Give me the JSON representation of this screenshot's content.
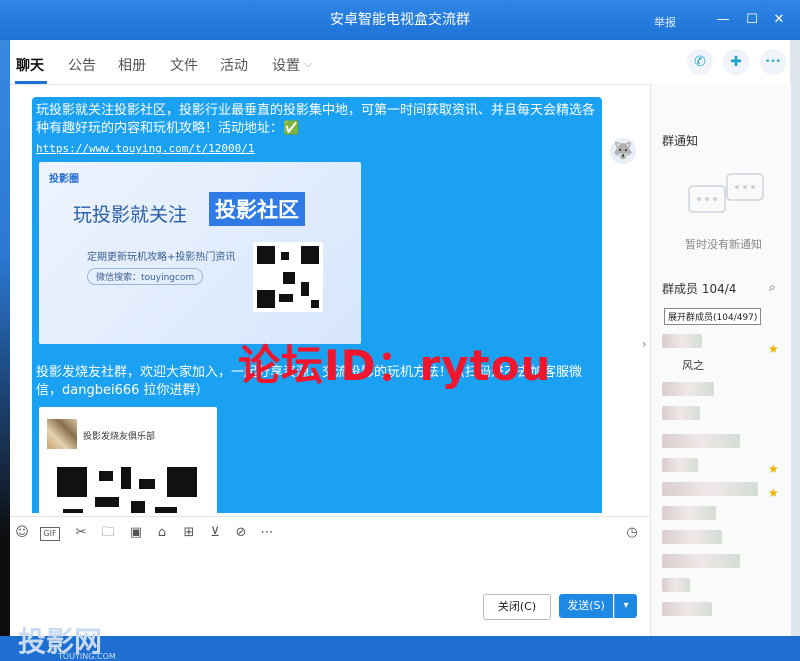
{
  "window": {
    "title": "安卓智能电视盒交流群",
    "report_label": "举报",
    "minimize": "—",
    "maximize": "☐",
    "close": "✕"
  },
  "tabs": [
    {
      "label": "聊天",
      "active": true
    },
    {
      "label": "公告"
    },
    {
      "label": "相册"
    },
    {
      "label": "文件"
    },
    {
      "label": "活动"
    },
    {
      "label": "设置"
    }
  ],
  "tabs_dropdown_glyph": "⌵",
  "top_icons": [
    "phone-icon",
    "message-plus-icon",
    "more-icon"
  ],
  "top_icon_glyphs": [
    "✆",
    "✚",
    "•••"
  ],
  "message": {
    "text1": "玩投影就关注投影社区，投影行业最垂直的投影集中地，可第一时间获取资讯、并且每天会精选各种有趣好玩的内容和玩机攻略！活动地址：✅",
    "link": "https://www.touying.com/t/12000/1",
    "card1": {
      "logo": "投影圈",
      "headline": "玩投影就关注",
      "highlight": "投影社区",
      "subline": "定期更新玩机攻略+投影热门资讯",
      "wechat": "微信搜索：touyingcom"
    },
    "text2": "投影发烧友社群，欢迎大家加入，一起分享资源，交流投影的玩机方法！（扫码进不去加客服微信，dangbei666 拉你进群）",
    "card2": {
      "group_name": "投影发烧友俱乐部"
    }
  },
  "watermark": "论坛ID：rytou",
  "input_watermark": "投影网",
  "input_watermark_sub": "TOUYING.COM",
  "toolbar": {
    "gif_label": "GIF",
    "icons": [
      "emoji-icon",
      "gif-icon",
      "scissors-icon",
      "folder-icon",
      "image-icon",
      "store-icon",
      "gift-icon",
      "vote-icon",
      "block-icon",
      "more-circle-icon"
    ],
    "glyphs": [
      "☺",
      "",
      "✂",
      "🗀",
      "▣",
      "⌂",
      "⊞",
      "⊻",
      "⊘",
      "⋯"
    ],
    "history_icon": "clock-icon",
    "history_glyph": "◷"
  },
  "buttons": {
    "close": "关闭(C)",
    "send": "发送(S)",
    "send_dropdown": "▾"
  },
  "sidebar": {
    "notice_title": "群通知",
    "notice_empty": "暂时没有新通知",
    "members_title": "群成员 104/4",
    "tooltip": "展开群成员(104/497)",
    "visible_member_name": "风之"
  },
  "colors": {
    "accent": "#1e73d6",
    "bubble": "#1aa1f2",
    "watermark": "#f0162e"
  }
}
